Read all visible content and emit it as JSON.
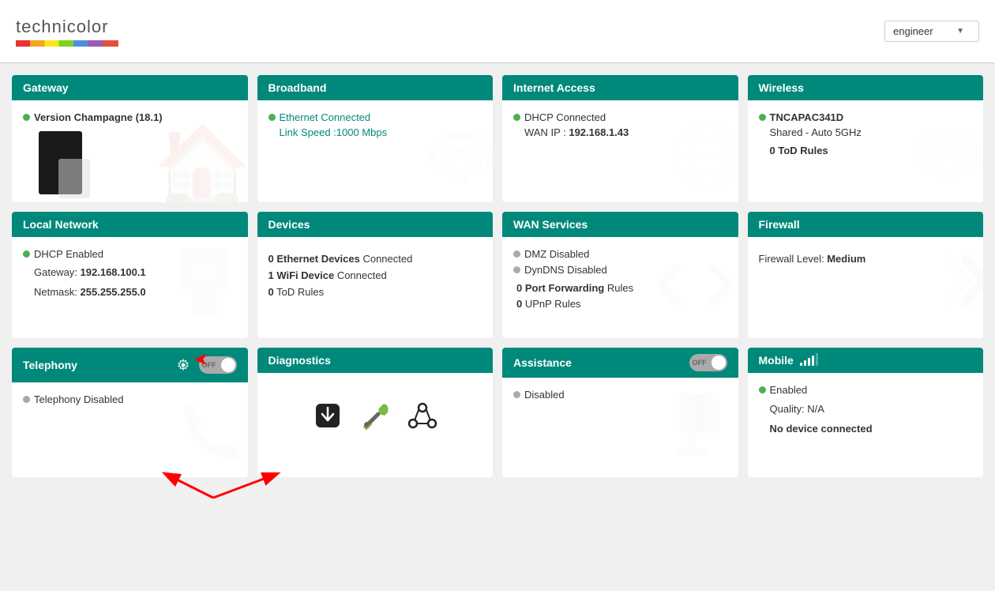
{
  "header": {
    "brand": "technicolor",
    "user_label": "engineer",
    "chevron": "▼"
  },
  "cards": {
    "gateway": {
      "title": "Gateway",
      "status_dot": "green",
      "version": "Version Champagne (18.1)"
    },
    "broadband": {
      "title": "Broadband",
      "status_dot": "green",
      "line1": "Ethernet Connected",
      "line2": "Link Speed :1000 Mbps"
    },
    "internet": {
      "title": "Internet Access",
      "status_dot": "green",
      "line1": "DHCP Connected",
      "line2_label": "WAN IP : ",
      "line2_value": "192.168.1.43"
    },
    "wireless": {
      "title": "Wireless",
      "status_dot": "green",
      "ssid": "TNCAPAC341D",
      "mode": "Shared - Auto 5GHz",
      "tod": "0 ToD Rules"
    },
    "local_network": {
      "title": "Local Network",
      "status_dot": "green",
      "dhcp": "DHCP Enabled",
      "gateway_label": "Gateway: ",
      "gateway_value": "192.168.100.1",
      "netmask_label": "Netmask: ",
      "netmask_value": "255.255.255.0"
    },
    "devices": {
      "title": "Devices",
      "eth_count": "0",
      "eth_label": " Ethernet Devices",
      "eth_suffix": " Connected",
      "wifi_count": "1",
      "wifi_label": " WiFi Device",
      "wifi_suffix": " Connected",
      "tod_count": "0",
      "tod_label": " ToD Rules"
    },
    "wan_services": {
      "title": "WAN Services",
      "dmz": "DMZ Disabled",
      "dyndns": "DynDNS Disabled",
      "pf_count": "0",
      "pf_label": " Port Forwarding",
      "pf_suffix": " Rules",
      "upnp_count": "0",
      "upnp_label": " UPnP Rules"
    },
    "firewall": {
      "title": "Firewall",
      "label": "Firewall Level: ",
      "level": "Medium"
    },
    "telephony": {
      "title": "Telephony",
      "toggle_state": "OFF",
      "status_dot": "gray",
      "status": "Telephony Disabled"
    },
    "diagnostics": {
      "title": "Diagnostics"
    },
    "assistance": {
      "title": "Assistance",
      "toggle_state": "OFF",
      "status_dot": "gray",
      "status": "Disabled"
    },
    "mobile": {
      "title": "Mobile",
      "status_dot": "green",
      "enabled": "Enabled",
      "quality_label": "Quality: ",
      "quality_value": "N/A",
      "no_device": "No device connected"
    }
  }
}
